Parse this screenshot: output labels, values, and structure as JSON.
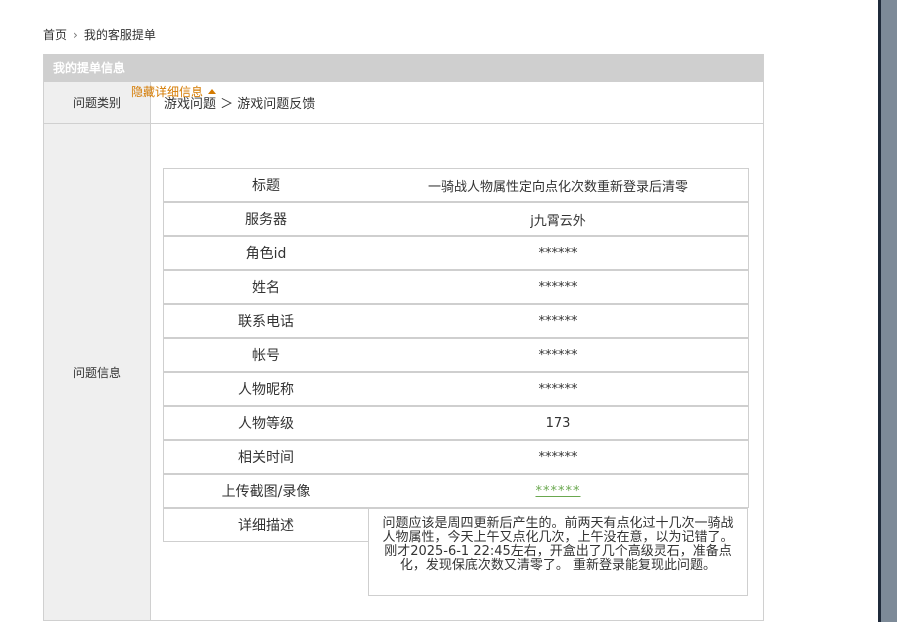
{
  "breadcrumb": {
    "home": "首页",
    "current": "我的客服提单"
  },
  "panel": {
    "title": "我的提单信息"
  },
  "category": {
    "label": "问题类别",
    "value": "游戏问题 ＞ 游戏问题反馈"
  },
  "info": {
    "label": "问题信息",
    "toggle_label": "隐藏详细信息",
    "rows": [
      {
        "label": "标题",
        "value": "一骑战人物属性定向点化次数重新登录后清零"
      },
      {
        "label": "服务器",
        "value": "j九霄云外"
      },
      {
        "label": "角色id",
        "value": "******"
      },
      {
        "label": "姓名",
        "value": "******"
      },
      {
        "label": "联系电话",
        "value": "******"
      },
      {
        "label": "帐号",
        "value": "******"
      },
      {
        "label": "人物昵称",
        "value": "******"
      },
      {
        "label": "人物等级",
        "value": "173"
      },
      {
        "label": "相关时间",
        "value": "******"
      },
      {
        "label": "上传截图/录像",
        "value": "******"
      },
      {
        "label": "详细描述",
        "value": "问题应该是周四更新后产生的。前两天有点化过十几次一骑战人物属性，今天上午又点化几次，上午没在意，以为记错了。 刚才2025-6-1 22:45左右，开盒出了几个高级灵石，准备点化，发现保底次数又清零了。 重新登录能复现此问题。"
      }
    ]
  }
}
